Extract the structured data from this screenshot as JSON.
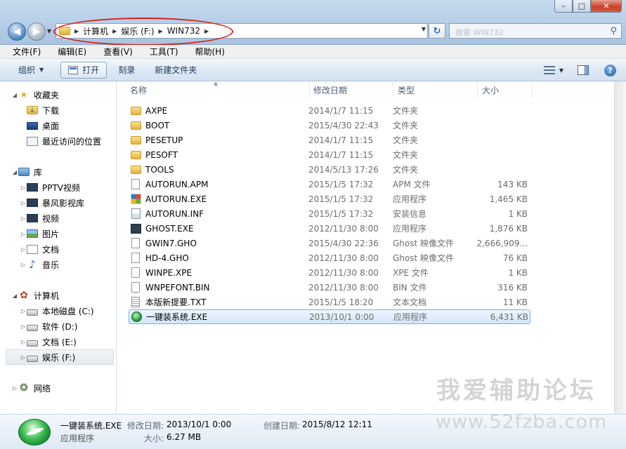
{
  "address": {
    "crumbs": [
      "计算机",
      "娱乐 (F:)",
      "WIN732"
    ],
    "search_placeholder": "搜索 WIN732"
  },
  "menu": [
    "文件(F)",
    "编辑(E)",
    "查看(V)",
    "工具(T)",
    "帮助(H)"
  ],
  "toolbar": {
    "organize": "组织",
    "open": "打开",
    "burn": "刻录",
    "new_folder": "新建文件夹"
  },
  "nav": {
    "favorites": "收藏夹",
    "downloads": "下载",
    "desktop": "桌面",
    "recent": "最近访问的位置",
    "libraries": "库",
    "pptv": "PPTV视频",
    "baofeng": "暴风影视库",
    "videos": "视频",
    "pictures": "图片",
    "documents": "文档",
    "music": "音乐",
    "computer": "计算机",
    "drive_c": "本地磁盘 (C:)",
    "drive_d": "软件 (D:)",
    "drive_e": "文档 (E:)",
    "drive_f": "娱乐 (F:)",
    "network": "网络"
  },
  "columns": {
    "name": "名称",
    "date": "修改日期",
    "type": "类型",
    "size": "大小"
  },
  "files": [
    {
      "name": "AXPE",
      "date": "2014/1/7 11:15",
      "type": "文件夹",
      "size": "",
      "icon": "folder"
    },
    {
      "name": "BOOT",
      "date": "2015/4/30 22:43",
      "type": "文件夹",
      "size": "",
      "icon": "folder"
    },
    {
      "name": "PESETUP",
      "date": "2014/1/7 11:15",
      "type": "文件夹",
      "size": "",
      "icon": "folder"
    },
    {
      "name": "PESOFT",
      "date": "2014/1/7 11:15",
      "type": "文件夹",
      "size": "",
      "icon": "folder"
    },
    {
      "name": "TOOLS",
      "date": "2014/5/13 17:26",
      "type": "文件夹",
      "size": "",
      "icon": "folder"
    },
    {
      "name": "AUTORUN.APM",
      "date": "2015/1/5 17:32",
      "type": "APM 文件",
      "size": "143 KB",
      "icon": "file"
    },
    {
      "name": "AUTORUN.EXE",
      "date": "2015/1/5 17:32",
      "type": "应用程序",
      "size": "1,465 KB",
      "icon": "exe"
    },
    {
      "name": "AUTORUN.INF",
      "date": "2015/1/5 17:32",
      "type": "安装信息",
      "size": "1 KB",
      "icon": "inf"
    },
    {
      "name": "GHOST.EXE",
      "date": "2012/11/30 8:00",
      "type": "应用程序",
      "size": "1,876 KB",
      "icon": "ghost"
    },
    {
      "name": "GWIN7.GHO",
      "date": "2015/4/30 22:36",
      "type": "Ghost 映像文件",
      "size": "2,666,909...",
      "icon": "file"
    },
    {
      "name": "HD-4.GHO",
      "date": "2012/11/30 8:00",
      "type": "Ghost 映像文件",
      "size": "76 KB",
      "icon": "file"
    },
    {
      "name": "WINPE.XPE",
      "date": "2012/11/30 8:00",
      "type": "XPE 文件",
      "size": "1 KB",
      "icon": "file"
    },
    {
      "name": "WNPEFONT.BIN",
      "date": "2012/11/30 8:00",
      "type": "BIN 文件",
      "size": "316 KB",
      "icon": "file"
    },
    {
      "name": "本版新提要.TXT",
      "date": "2015/1/5 18:20",
      "type": "文本文档",
      "size": "11 KB",
      "icon": "txt"
    },
    {
      "name": "一键装系统.EXE",
      "date": "2013/10/1 0:00",
      "type": "应用程序",
      "size": "6,431 KB",
      "icon": "green"
    }
  ],
  "details": {
    "name": "一键装系统.EXE",
    "type": "应用程序",
    "modified_label": "修改日期:",
    "modified_value": "2013/10/1 0:00",
    "created_label": "创建日期:",
    "created_value": "2015/8/12 12:11",
    "size_label": "大小:",
    "size_value": "6.27 MB"
  },
  "watermark": {
    "line1": "我爱辅助论坛",
    "line2": "www.52fzba.com"
  }
}
